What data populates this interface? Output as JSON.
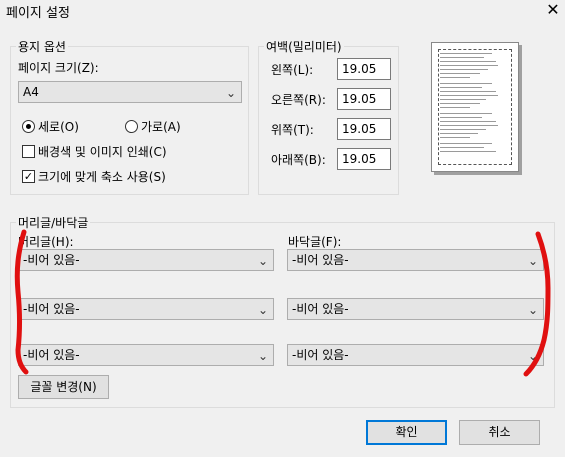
{
  "window": {
    "title": "페이지 설정",
    "close_glyph": "✕"
  },
  "paper_options": {
    "legend": "용지 옵션",
    "page_size_label": "페이지 크기(Z):",
    "page_size_value": "A4",
    "orientation_portrait": "세로(O)",
    "orientation_landscape": "가로(A)",
    "orientation_selected": "portrait",
    "print_background_label": "배경색 및 이미지 인쇄(C)",
    "print_background_checked": false,
    "shrink_to_fit_label": "크기에 맞게 축소 사용(S)",
    "shrink_to_fit_checked": true
  },
  "margins": {
    "legend": "여백(밀리미터)",
    "left_label": "왼쪽(L):",
    "left_value": "19.05",
    "right_label": "오른쪽(R):",
    "right_value": "19.05",
    "top_label": "위쪽(T):",
    "top_value": "19.05",
    "bottom_label": "아래쪽(B):",
    "bottom_value": "19.05"
  },
  "header_footer": {
    "legend": "머리글/바닥글",
    "header_label": "머리글(H):",
    "footer_label": "바닥글(F):",
    "header_values": [
      "-비어 있음-",
      "-비어 있음-",
      "-비어 있음-"
    ],
    "footer_values": [
      "-비어 있음-",
      "-비어 있음-",
      "-비어 있음-"
    ],
    "font_button": "글꼴 변경(N)"
  },
  "buttons": {
    "ok": "확인",
    "cancel": "취소"
  },
  "icons": {
    "chevron": "⌄",
    "check": "✓"
  },
  "annotation_color": "#e01010"
}
